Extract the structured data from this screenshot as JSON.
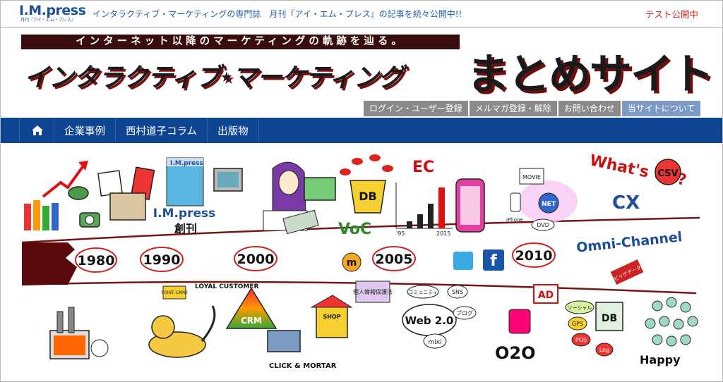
{
  "logo": {
    "main": "I.M.press",
    "sub": "月刊『アイ・エム・プレス』"
  },
  "tagline": "インタラクティブ・マーケティングの専門誌　月刊『アイ・エム・プレス』の記事を続々公開中!!",
  "test_link": "テスト公開中",
  "banner": {
    "catch": "インターネット以降のマーケティングの軌跡を辿る。",
    "title_a": "インタラクティブ",
    "title_b": "マーケティング",
    "star": "★",
    "matome": "まとめサイト"
  },
  "subnav": [
    {
      "label": "ログイン・ユーザー登録"
    },
    {
      "label": "メルマガ登録・解除"
    },
    {
      "label": "お問い合わせ"
    },
    {
      "label": "当サイトについて"
    }
  ],
  "mainnav": [
    {
      "label": "企業事例"
    },
    {
      "label": "西村道子コラム"
    },
    {
      "label": "出版物"
    }
  ],
  "icons": {
    "home": "home-icon"
  },
  "hero": {
    "years": [
      "1980",
      "1990",
      "2000",
      "2005",
      "2010"
    ],
    "labels": {
      "impress": "I.M.press",
      "souk": "創刊",
      "voc": "VoC",
      "db": "DB",
      "ec": "EC",
      "whats_up": "What's UP?",
      "cx": "CX",
      "csv": "CSV",
      "omni": "Omni-Channel",
      "crm": "CRM",
      "loyal": "LOYAL CUSTOMER",
      "click": "CLICK & MORTAR",
      "web20": "Web 2.0",
      "mixi": "mixi",
      "sns": "SNS",
      "blog": "ブログ",
      "community": "コミュニティ",
      "privacy": "個人情報保護法",
      "ad": "AD",
      "o2o": "O2O",
      "happy": "Happy",
      "gps": "GPS",
      "pos": "POS",
      "log": "Log",
      "social": "ソーシャル",
      "bigdata": "ビッグデータ",
      "point": "POINT CARD",
      "net": "NET",
      "movie": "MOVIE",
      "dvd": "DVD",
      "iphone": "iPhone",
      "shop": "SHOP",
      "f": "f",
      "m": "m",
      "label_1995": "'95",
      "label_2015": "2015"
    }
  },
  "colors": {
    "nav_blue": "#0d4592",
    "banner_dark": "#3a0d0d",
    "accent_red": "#d91f1f",
    "subnav_gray": "#8a8a8a",
    "subnav_active": "#7d99c4"
  }
}
